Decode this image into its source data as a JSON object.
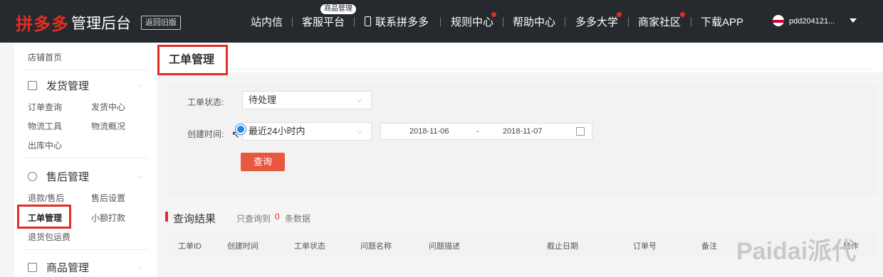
{
  "header": {
    "logo": "拼多多",
    "subtitle": "管理后台",
    "back_label": "返回旧版",
    "nav": [
      {
        "label": "站内信"
      },
      {
        "label": "客服平台",
        "tag": "商品管理"
      },
      {
        "label": "联系拼多多"
      },
      {
        "label": "规则中心"
      },
      {
        "label": "帮助中心"
      },
      {
        "label": "多多大学"
      },
      {
        "label": "商家社区"
      },
      {
        "label": "下载APP"
      }
    ],
    "username": "pdd204121..."
  },
  "sidebar": {
    "home": "店铺首页",
    "groups": [
      {
        "title": "发货管理",
        "items": [
          "订单查询",
          "发货中心",
          "物流工具",
          "物流概况",
          "出库中心"
        ]
      },
      {
        "title": "售后管理",
        "items": [
          "退款/售后",
          "售后设置",
          "工单管理",
          "小额打款",
          "退货包运费"
        ]
      },
      {
        "title": "商品管理",
        "items": []
      }
    ]
  },
  "main": {
    "page_title": "工单管理",
    "filters": {
      "status_label": "工单状态:",
      "status_value": "待处理",
      "time_label": "创建时间:",
      "time_value": "最近24小时内",
      "date_from": "2018-11-06",
      "date_sep": "-",
      "date_to": "2018-11-07",
      "query_button": "查询"
    },
    "results": {
      "title": "查询结果",
      "note": "只查询到",
      "count": "0",
      "unit": "条数据"
    },
    "table_columns": [
      "工单ID",
      "创建时间",
      "工单状态",
      "问题名称",
      "问题描述",
      "截止日期",
      "订单号",
      "备注",
      "操作"
    ]
  },
  "watermark": "Paidai派代",
  "colors": {
    "accent": "#e02e24",
    "topbar": "#26292e",
    "button": "#e8573f"
  }
}
